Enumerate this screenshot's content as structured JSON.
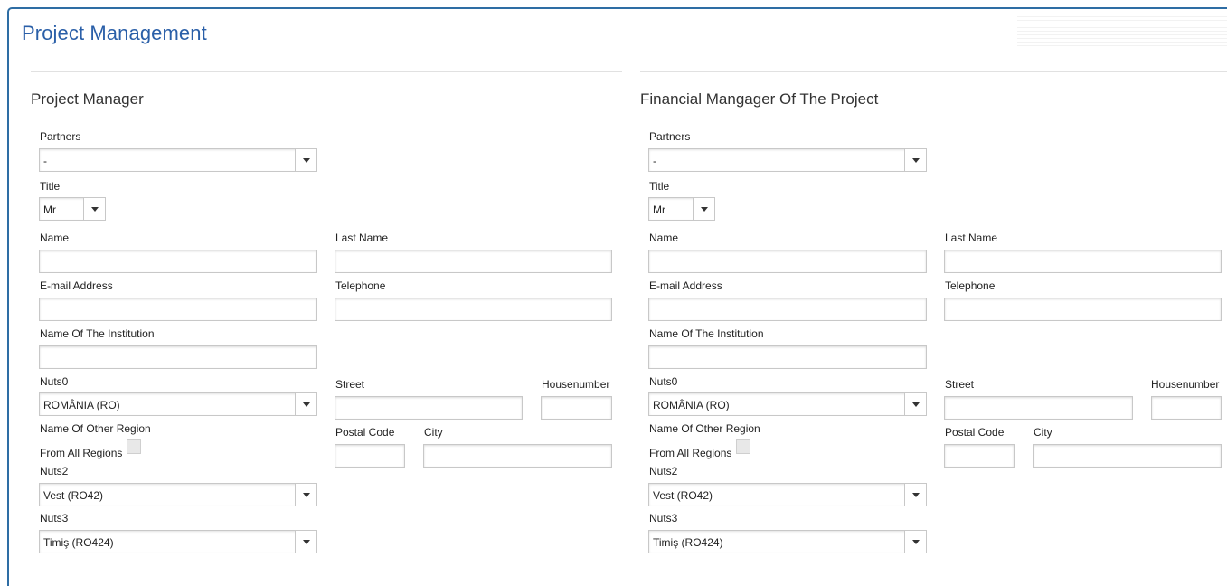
{
  "page": {
    "title": "Project Management"
  },
  "sections": [
    {
      "heading": "Project Manager",
      "partners_label": "Partners",
      "partners_value": "-",
      "title_label": "Title",
      "title_value": "Mr",
      "name_label": "Name",
      "last_name_label": "Last Name",
      "email_label": "E-mail Address",
      "telephone_label": "Telephone",
      "institution_label": "Name Of The Institution",
      "nuts0_label": "Nuts0",
      "nuts0_value": "ROMÂNIA (RO)",
      "street_label": "Street",
      "housenumber_label": "Housenumber",
      "other_region_label": "Name Of Other Region",
      "postal_code_label": "Postal Code",
      "city_label": "City",
      "all_regions_label": "From All Regions",
      "nuts2_label": "Nuts2",
      "nuts2_value": "Vest (RO42)",
      "nuts3_label": "Nuts3",
      "nuts3_value": "Timiş (RO424)"
    },
    {
      "heading": "Financial Mangager Of The Project",
      "partners_label": "Partners",
      "partners_value": "-",
      "title_label": "Title",
      "title_value": "Mr",
      "name_label": "Name",
      "last_name_label": "Last Name",
      "email_label": "E-mail Address",
      "telephone_label": "Telephone",
      "institution_label": "Name Of The Institution",
      "nuts0_label": "Nuts0",
      "nuts0_value": "ROMÂNIA (RO)",
      "street_label": "Street",
      "housenumber_label": "Housenumber",
      "other_region_label": "Name Of Other Region",
      "postal_code_label": "Postal Code",
      "city_label": "City",
      "all_regions_label": "From All Regions",
      "nuts2_label": "Nuts2",
      "nuts2_value": "Vest (RO42)",
      "nuts3_label": "Nuts3",
      "nuts3_value": "Timiş (RO424)"
    }
  ],
  "colors": {
    "title": "#2a5fa8",
    "frame_border": "#2e6da4",
    "input_border": "#c8c8c8"
  },
  "icons": {
    "dropdown": "chevron-down-icon"
  }
}
